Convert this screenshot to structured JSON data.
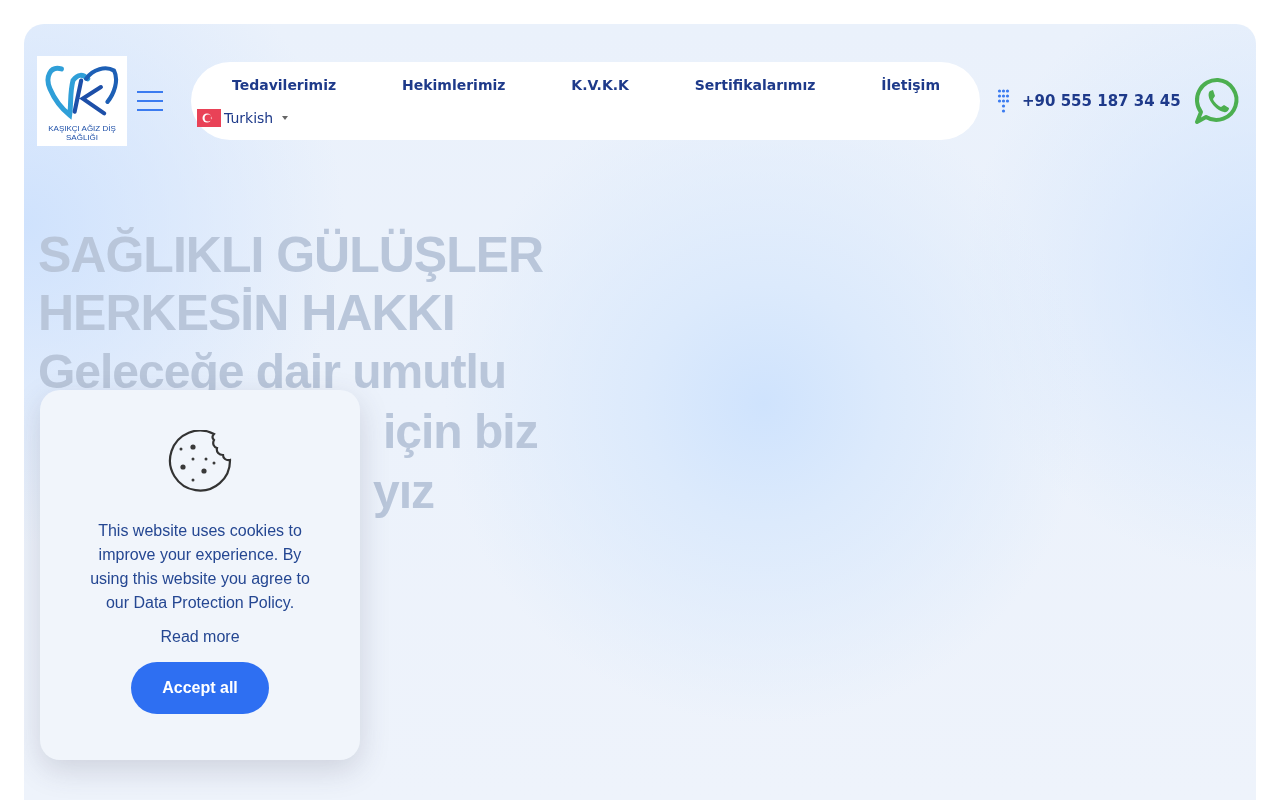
{
  "logo": {
    "caption": "KAŞIKÇI AĞIZ DİŞ SAĞLIĞI"
  },
  "nav": {
    "items": [
      "Tedavilerimiz",
      "Hekimlerimiz",
      "K.V.K.K",
      "Sertifikalarımız",
      "İletişim"
    ],
    "language": "Turkish"
  },
  "phone": "+90 555 187 34 45",
  "hero": {
    "title_lines": [
      "SAĞLIKLI GÜLÜŞLER",
      "HERKESİN HAKKI"
    ],
    "subtitle_fragments": [
      "Geleceğe dair umutlu",
      "için biz",
      "yız"
    ]
  },
  "cookie_banner": {
    "message": "This website uses cookies to improve your experience. By using this website you agree to our Data Protection Policy.",
    "link": "Read more",
    "button": "Accept all"
  }
}
